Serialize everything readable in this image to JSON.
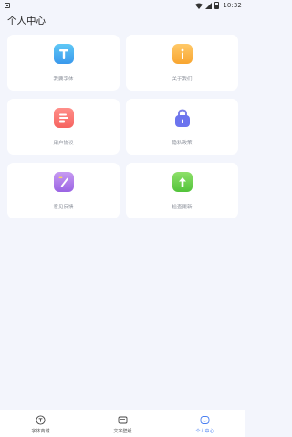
{
  "status_bar": {
    "time": "10:32"
  },
  "page_title": "个人中心",
  "cards": [
    {
      "label": "我要字体",
      "icon": "font-icon"
    },
    {
      "label": "关于我们",
      "icon": "info-icon"
    },
    {
      "label": "用户协议",
      "icon": "document-icon"
    },
    {
      "label": "隐私政策",
      "icon": "lock-icon"
    },
    {
      "label": "意见反馈",
      "icon": "edit-icon"
    },
    {
      "label": "检查更新",
      "icon": "upload-arrow-icon"
    }
  ],
  "tabbar": {
    "tabs": [
      {
        "label": "字体商城",
        "icon": "font-store-icon",
        "active": false
      },
      {
        "label": "文字壁纸",
        "icon": "text-wallpaper-icon",
        "active": false
      },
      {
        "label": "个人中心",
        "icon": "profile-icon",
        "active": true
      }
    ]
  },
  "colors": {
    "accent": "#4a7ff1",
    "background": "#f3f5fc"
  }
}
